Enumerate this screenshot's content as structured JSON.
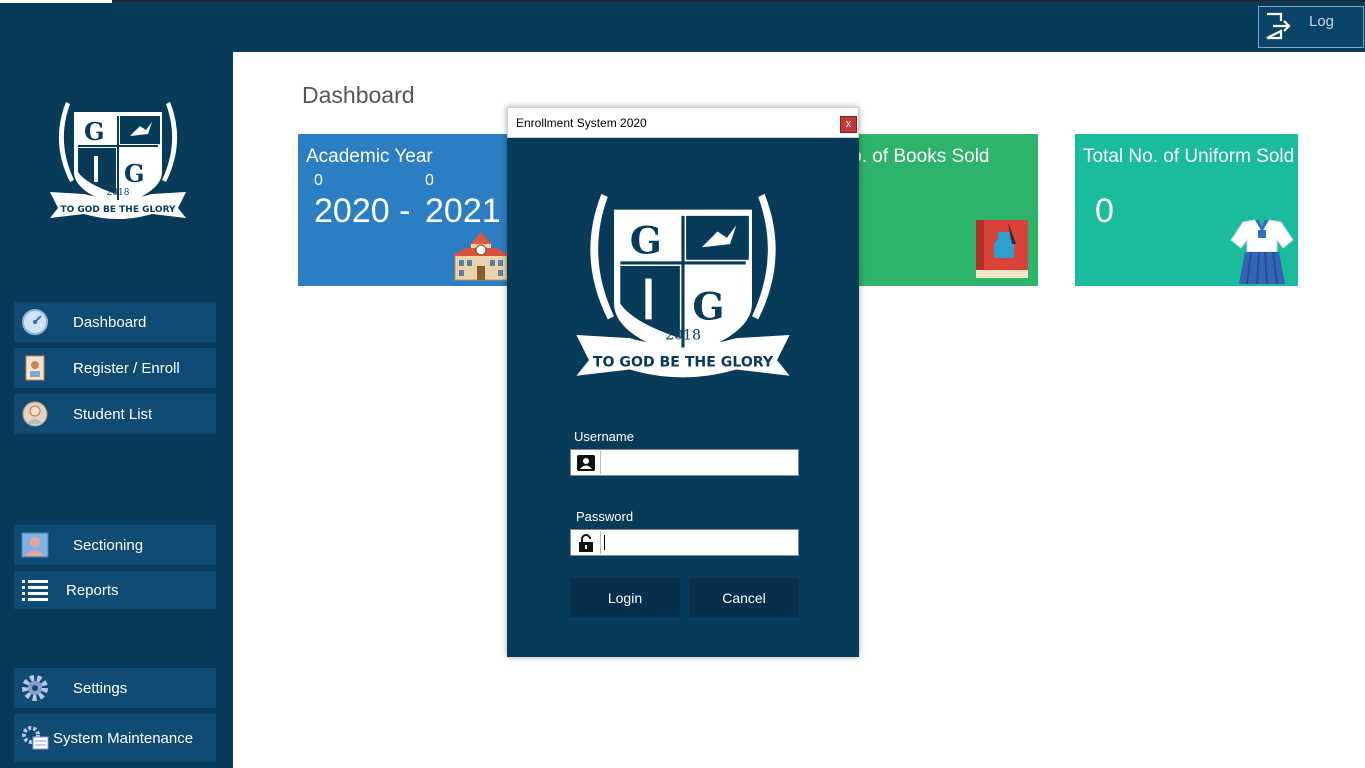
{
  "topbar": {
    "logout_label": "Log"
  },
  "sidebar": {
    "logo": {
      "year": "2018",
      "motto": "TO GOD BE THE GLORY"
    },
    "items": [
      {
        "label": "Dashboard",
        "icon": "speedometer-icon"
      },
      {
        "label": "Register / Enroll",
        "icon": "id-badge-icon"
      },
      {
        "label": "Student List",
        "icon": "student-icon"
      },
      {
        "label": "Sectioning",
        "icon": "user-card-icon"
      },
      {
        "label": "Reports",
        "icon": "list-icon"
      },
      {
        "label": "Settings",
        "icon": "gear-icon"
      },
      {
        "label": "System Maintenance",
        "icon": "gears-icon"
      }
    ]
  },
  "main": {
    "title": "Dashboard",
    "cards": {
      "year": {
        "title": "Academic Year",
        "start_small": "0",
        "end_small": "0",
        "start": "2020 -",
        "end": "2021",
        "icon": "school-building-icon",
        "color": "#2b7ec1"
      },
      "books": {
        "title": "Total No. of Books Sold",
        "icon": "book-ink-icon",
        "color": "#2eb36a"
      },
      "uniform": {
        "title": "Total No. of Uniform Sold",
        "value": "0",
        "icon": "uniform-icon",
        "color": "#1bbc9b"
      }
    }
  },
  "dialog": {
    "title": "Enrollment System 2020",
    "close_label": "x",
    "logo": {
      "year": "2018",
      "motto": "TO GOD BE THE GLORY"
    },
    "username": {
      "label": "Username",
      "value": "",
      "icon": "user-card-icon"
    },
    "password": {
      "label": "Password",
      "value": "",
      "icon": "lock-icon"
    },
    "login_label": "Login",
    "cancel_label": "Cancel"
  },
  "colors": {
    "navy": "#083a5a",
    "nav_item": "#0f4b72",
    "button": "#06304b",
    "close": "#c0393b"
  }
}
